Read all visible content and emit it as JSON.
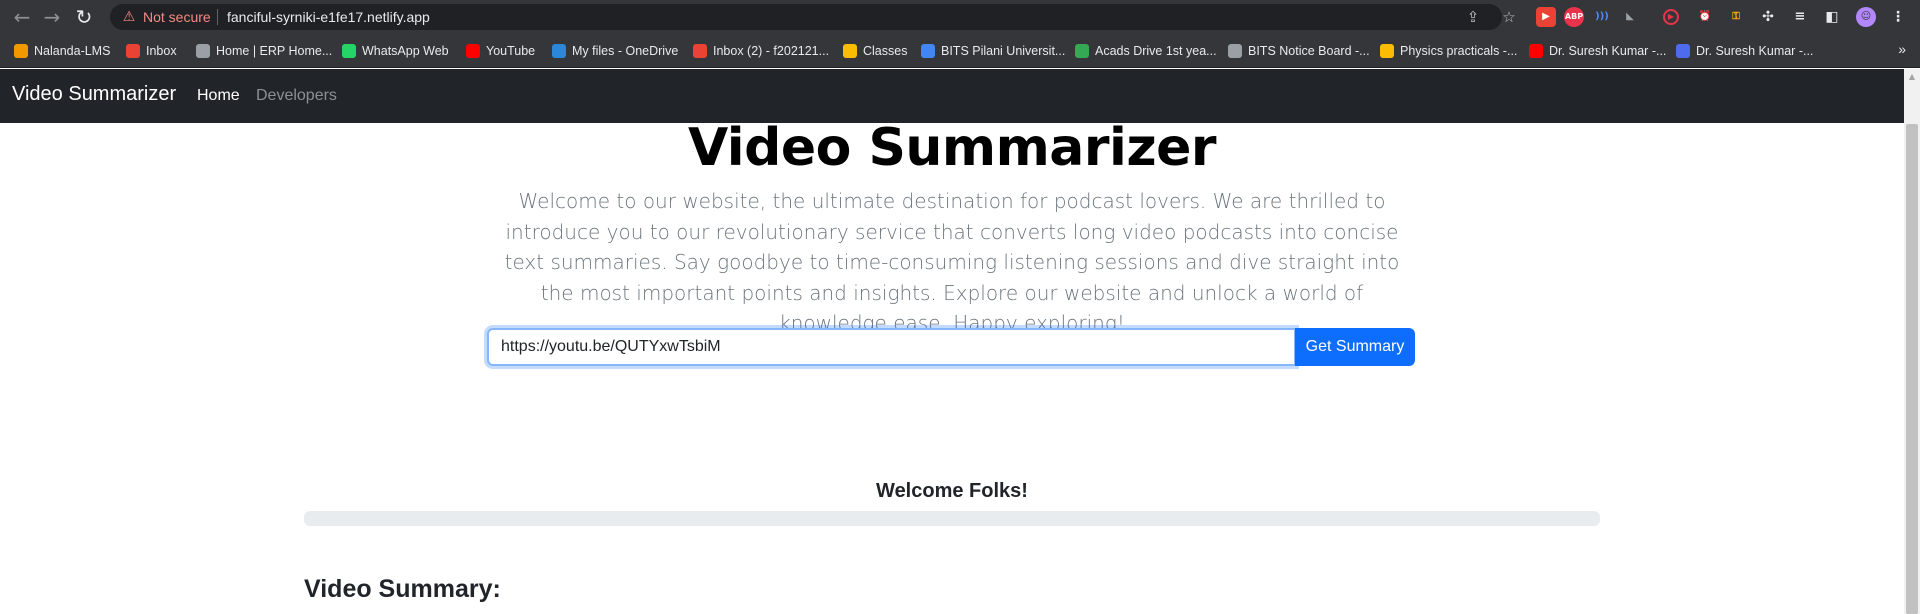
{
  "browser": {
    "not_secure": "Not secure",
    "url": "fanciful-syrniki-e1fe17.netlify.app",
    "icons": [
      "back-arrow-icon",
      "forward-arrow-icon",
      "reload-icon",
      "warning-icon",
      "share-icon",
      "star-icon",
      "puzzle-icon",
      "profile-icon",
      "menu-dots-icon"
    ],
    "bookmarks": [
      {
        "label": "Nalanda-LMS",
        "color": "#f29900"
      },
      {
        "label": "Inbox",
        "color": "#ea4335"
      },
      {
        "label": "Home | ERP Home...",
        "color": "#9aa0a6"
      },
      {
        "label": "WhatsApp Web",
        "color": "#25d366"
      },
      {
        "label": "YouTube",
        "color": "#ff0000"
      },
      {
        "label": "My files - OneDrive",
        "color": "#2b88d8"
      },
      {
        "label": "Inbox (2) - f202121...",
        "color": "#ea4335"
      },
      {
        "label": "Classes",
        "color": "#fbbc04"
      },
      {
        "label": "BITS Pilani Universit...",
        "color": "#4285f4"
      },
      {
        "label": "Acads Drive 1st yea...",
        "color": "#34a853"
      },
      {
        "label": "BITS Notice Board -...",
        "color": "#9aa0a6"
      },
      {
        "label": "Physics practicals -...",
        "color": "#fbbc04"
      },
      {
        "label": "Dr. Suresh Kumar -...",
        "color": "#ff0000"
      },
      {
        "label": "Dr. Suresh Kumar -...",
        "color": "#4f6bed"
      }
    ],
    "bookmarks_more": "»"
  },
  "navbar": {
    "brand": "Video Summarizer",
    "links": [
      {
        "label": "Home",
        "active": true
      },
      {
        "label": "Developers",
        "active": false
      }
    ]
  },
  "hero": {
    "title": "Video Summarizer",
    "lead": "Welcome to our website, the ultimate destination for podcast lovers. We are thrilled to introduce you to our revolutionary service that converts long video podcasts into concise text summaries. Say goodbye to time-consuming listening sessions and dive straight into the most important points and insights. Explore our website and unlock a world of knowledge ease. Happy exploring!"
  },
  "form": {
    "input_value": "https://youtu.be/QUTYxwTsbiM",
    "button_label": "Get Summary"
  },
  "status": {
    "welcome": "Welcome Folks!",
    "progress_percent": 0
  },
  "summary": {
    "heading": "Video Summary:"
  },
  "colors": {
    "primary": "#0d6efd",
    "navbar_bg": "#212529",
    "chrome_bg": "#35363a"
  }
}
